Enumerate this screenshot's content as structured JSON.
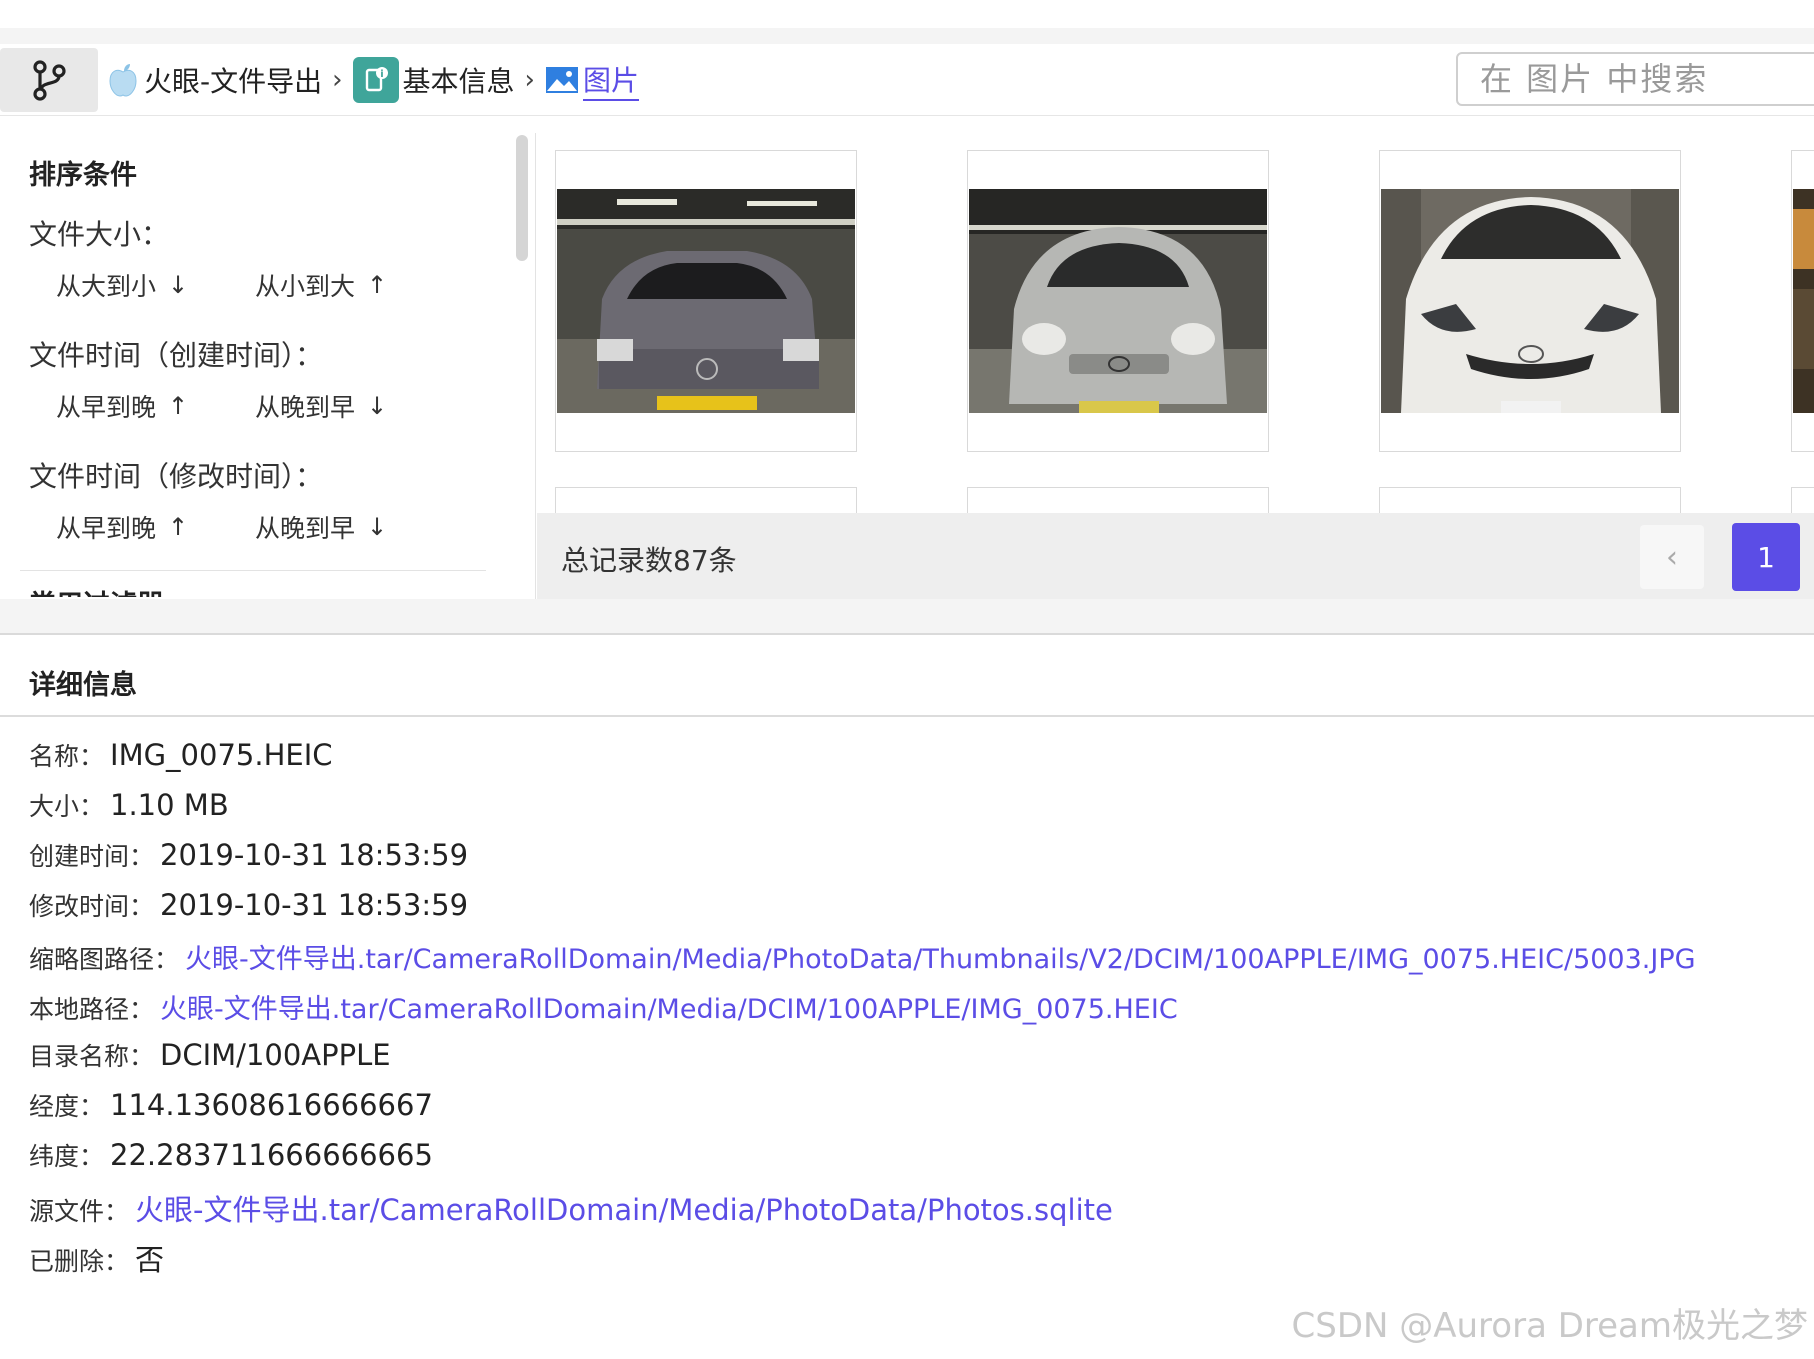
{
  "toolbar": {
    "breadcrumbs": [
      {
        "label": "火眼-文件导出",
        "icon": "apple-icon"
      },
      {
        "label": "基本信息",
        "icon": "info-app-icon"
      },
      {
        "label": "图片",
        "icon": "picture-icon"
      }
    ],
    "search_placeholder": "在 图片 中搜索"
  },
  "sort": {
    "title": "排序条件",
    "groups": [
      {
        "label": "文件大小：",
        "options": [
          {
            "label": "从大到小",
            "arrow": "↓"
          },
          {
            "label": "从小到大",
            "arrow": "↑"
          }
        ]
      },
      {
        "label": "文件时间（创建时间）：",
        "options": [
          {
            "label": "从早到晚",
            "arrow": "↑"
          },
          {
            "label": "从晚到早",
            "arrow": "↓"
          }
        ]
      },
      {
        "label": "文件时间（修改时间）：",
        "options": [
          {
            "label": "从早到晚",
            "arrow": "↑"
          },
          {
            "label": "从晚到早",
            "arrow": "↓"
          }
        ]
      }
    ],
    "next_section_title": "常用过滤器"
  },
  "gallery": {
    "total": "总记录数87条",
    "current_page": "1",
    "prev_icon": "chevron-left-icon"
  },
  "details": {
    "title": "详细信息",
    "fields": {
      "name": {
        "label": "名称：",
        "value": "IMG_0075.HEIC"
      },
      "size": {
        "label": "大小：",
        "value": "1.10 MB"
      },
      "created": {
        "label": "创建时间：",
        "value": "2019-10-31 18:53:59"
      },
      "modified": {
        "label": "修改时间：",
        "value": "2019-10-31 18:53:59"
      },
      "thumb_path": {
        "label": "缩略图路径：",
        "value": "火眼-文件导出.tar/CameraRollDomain/Media/PhotoData/Thumbnails/V2/DCIM/100APPLE/IMG_0075.HEIC/5003.JPG"
      },
      "local_path": {
        "label": "本地路径：",
        "value": "火眼-文件导出.tar/CameraRollDomain/Media/DCIM/100APPLE/IMG_0075.HEIC"
      },
      "dir": {
        "label": "目录名称：",
        "value": "DCIM/100APPLE"
      },
      "lon": {
        "label": "经度：",
        "value": "114.13608616666667"
      },
      "lat": {
        "label": "纬度：",
        "value": "22.283711666666665"
      },
      "source": {
        "label": "源文件：",
        "value": "火眼-文件导出.tar/CameraRollDomain/Media/PhotoData/Photos.sqlite"
      },
      "deleted": {
        "label": "已删除：",
        "value": "否"
      }
    }
  },
  "watermark": "CSDN @Aurora Dream极光之梦",
  "colors": {
    "accent": "#5b4de6",
    "link": "#5b4de6"
  }
}
